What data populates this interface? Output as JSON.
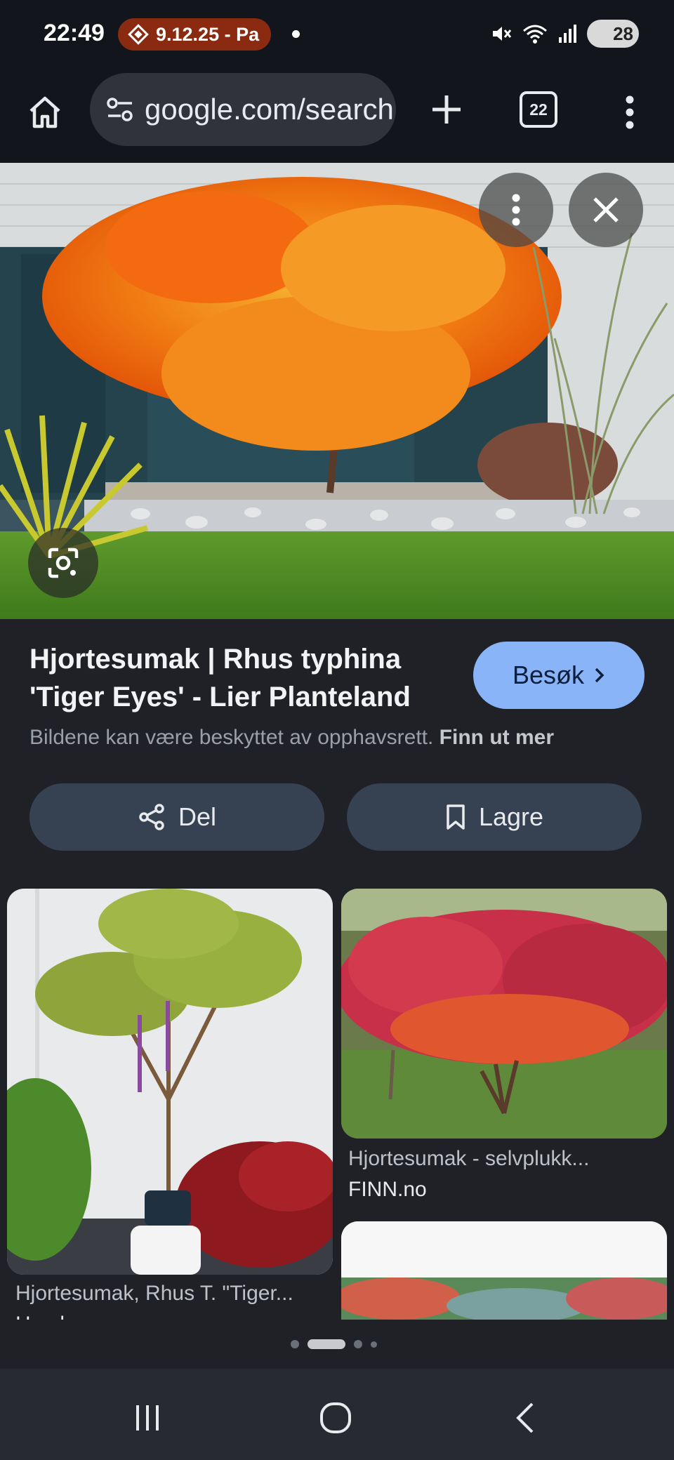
{
  "status_bar": {
    "time": "22:49",
    "notification_label": "9.12.25 - Pa",
    "battery": "28"
  },
  "browser": {
    "url": "google.com/search",
    "tab_count": "22"
  },
  "result": {
    "title": "Hjortesumak | Rhus typhina 'Tiger Eyes' - Lier Planteland",
    "visit_label": "Besøk",
    "copyright_text": "Bildene kan være beskyttet av opphavsrett.",
    "learn_more": "Finn ut mer",
    "share_label": "Del",
    "save_label": "Lagre"
  },
  "related": [
    {
      "title": "Hjortesumak, Rhus T. \"Tiger...",
      "source": "Hamkan"
    },
    {
      "title": "Hjortesumak - selvplukk...",
      "source": "FINN.no"
    }
  ],
  "colors": {
    "accent": "#8ab4f8",
    "background": "#1f2127",
    "chip": "#364152"
  }
}
